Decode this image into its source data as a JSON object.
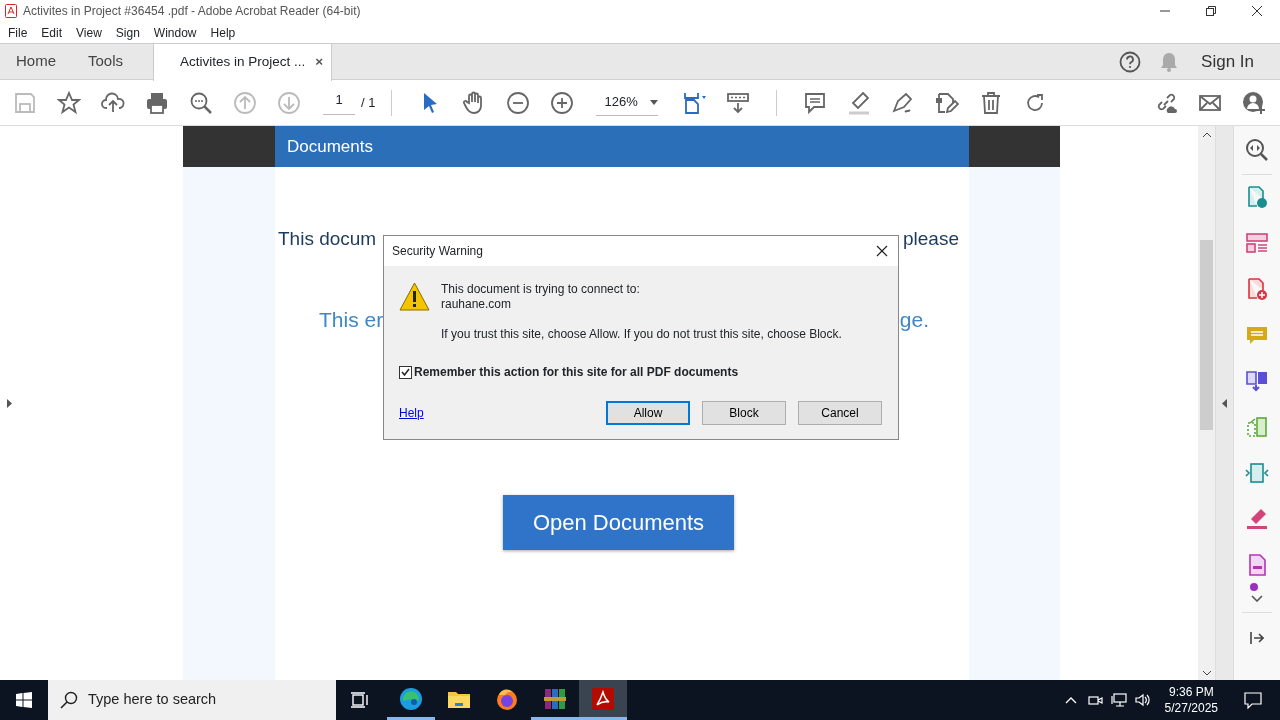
{
  "window": {
    "title": "Activites in Project #36454 .pdf - Adobe Acrobat Reader (64-bit)"
  },
  "menu": [
    "File",
    "Edit",
    "View",
    "Sign",
    "Window",
    "Help"
  ],
  "tabs": [
    {
      "label": "Home",
      "selected": false
    },
    {
      "label": "Tools",
      "selected": false
    },
    {
      "label": "Activites in Project ...",
      "selected": true,
      "close": "×"
    }
  ],
  "account": {
    "sign_in": "Sign In"
  },
  "toolbar": {
    "page_current": "1",
    "page_total": "/ 1",
    "zoom": "126%"
  },
  "document": {
    "header": "Documents",
    "line_1_left": "This docum",
    "line_1_right": "please",
    "line_2_left": "This er",
    "line_2_right": "ge.",
    "button": "Open Documents"
  },
  "dialog": {
    "title": "Security Warning",
    "message": "This document is trying to connect to:",
    "site": "rauhane.com",
    "advice": "If you trust this site, choose Allow. If you do not trust this site, choose Block.",
    "remember": {
      "label": "Remember this action for this site for all PDF documents",
      "checked": true
    },
    "help": "Help",
    "buttons": [
      {
        "label": "Allow",
        "default": true
      },
      {
        "label": "Block",
        "default": false
      },
      {
        "label": "Cancel",
        "default": false
      }
    ]
  },
  "taskbar": {
    "search_placeholder": "Type here to search",
    "time": "9:36 PM",
    "date": "5/27/2025",
    "apps": [
      {
        "kind": "edge",
        "running": true,
        "selected": false
      },
      {
        "kind": "explorer",
        "running": false,
        "selected": false
      },
      {
        "kind": "firefox",
        "running": false,
        "selected": false
      },
      {
        "kind": "winrar",
        "running": true,
        "selected": false
      },
      {
        "kind": "acrobat",
        "running": true,
        "selected": true
      }
    ]
  }
}
